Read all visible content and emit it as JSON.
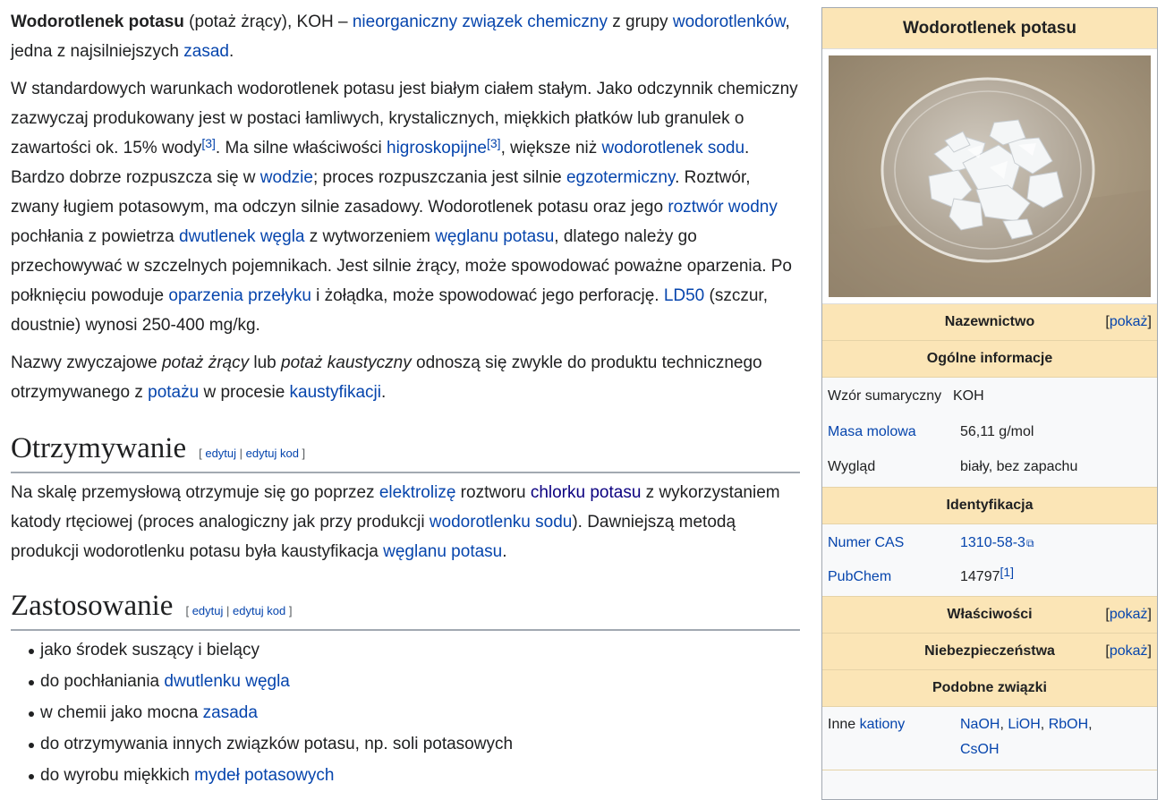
{
  "article": {
    "intro1": {
      "bold": "Wodorotlenek potasu",
      "t1": " (potaż żrący), KOH – ",
      "l1": "nieorganiczny związek chemiczny",
      "t2": " z grupy ",
      "l2": "wodorotlenków",
      "t3": ", jedna z najsilniejszych ",
      "l3": "zasad",
      "t4": "."
    },
    "intro2": {
      "t1": "W standardowych warunkach wodorotlenek potasu jest białym ciałem stałym. Jako odczynnik chemiczny zazwyczaj produkowany jest w postaci łamliwych, krystalicznych, miękkich płatków lub granulek o zawartości ok. 15% wody",
      "ref1": "[3]",
      "t2": ". Ma silne właściwości ",
      "l1": "higroskopijne",
      "ref2": "[3]",
      "t3": ", większe niż ",
      "l2": "wodorotlenek sodu",
      "t4": ". Bardzo dobrze rozpuszcza się w ",
      "l3": "wodzie",
      "t5": "; proces rozpuszczania jest silnie ",
      "l4": "egzotermiczny",
      "t6": ". Roztwór, zwany ługiem potasowym, ma odczyn silnie zasadowy. Wodorotlenek potasu oraz jego ",
      "l5": "roztwór wodny",
      "t7": " pochłania z powietrza ",
      "l6": "dwutlenek węgla",
      "t8": " z wytworzeniem ",
      "l7": "węglanu potasu",
      "t9": ", dlatego należy go przechowywać w szczelnych pojemnikach. Jest silnie żrący, może spowodować poważne oparzenia. Po połknięciu powoduje ",
      "l8": "oparzenia przełyku",
      "t10": " i żołądka, może spowodować jego perforację. ",
      "l9": "LD50",
      "t11": " (szczur, doustnie) wynosi 250-400 mg/kg."
    },
    "intro3": {
      "t1": "Nazwy zwyczajowe ",
      "i1": "potaż żrący",
      "t2": " lub ",
      "i2": "potaż kaustyczny",
      "t3": " odnoszą się zwykle do produktu technicznego otrzymywanego z ",
      "l1": "potażu",
      "t4": " w procesie ",
      "l2": "kaustyfikacji",
      "t5": "."
    },
    "edit": {
      "open": "[ ",
      "edit": "edytuj",
      "sep": " | ",
      "edit_code": "edytuj kod",
      "close": " ]"
    },
    "sec1": {
      "title": "Otrzymywanie",
      "p": {
        "t1": "Na skalę przemysłową otrzymuje się go poprzez ",
        "l1": "elektrolizę",
        "t2": " roztworu ",
        "l2": "chlorku potasu",
        "t3": " z wykorzystaniem katody rtęciowej (proces analogiczny jak przy produkcji ",
        "l3": "wodorotlenku sodu",
        "t4": "). Dawniejszą metodą produkcji wodorotlenku potasu była kaustyfikacja ",
        "l4": "węglanu potasu",
        "t5": "."
      }
    },
    "sec2": {
      "title": "Zastosowanie",
      "items": [
        {
          "t": "jako środek suszący i bielący"
        },
        {
          "t": "do pochłaniania ",
          "l": "dwutlenku węgla"
        },
        {
          "t": "w chemii jako mocna ",
          "l": "zasada"
        },
        {
          "t": "do otrzymywania innych związków potasu, np. soli potasowych"
        },
        {
          "t": "do wyrobu miękkich ",
          "l": "mydeł potasowych"
        }
      ]
    }
  },
  "infobox": {
    "title": "Wodorotlenek potasu",
    "show": "[pokaż]",
    "show_open": "[",
    "show_link": "pokaż",
    "show_close": "]",
    "sections": {
      "nazewnictwo": "Nazewnictwo",
      "ogolne": "Ogólne informacje",
      "identyfikacja": "Identyfikacja",
      "wlasciwosci": "Właściwości",
      "niebezpieczenstwa": "Niebezpieczeństwa",
      "podobne": "Podobne związki"
    },
    "rows": {
      "wzor_k": "Wzór sumaryczny",
      "wzor_v": "KOH",
      "masa_k": "Masa molowa",
      "masa_v": "56,11 g/mol",
      "wyglad_k": "Wygląd",
      "wyglad_v": "biały, bez zapachu",
      "cas_k": "Numer CAS",
      "cas_v": "1310-58-3",
      "pubchem_k": "PubChem",
      "pubchem_v": "14797",
      "pubchem_ref": "[1]",
      "inne_k1": "Inne ",
      "inne_k2": "kationy",
      "inne_v": [
        "NaOH",
        "LiOH",
        "RbOH",
        "CsOH"
      ]
    }
  }
}
